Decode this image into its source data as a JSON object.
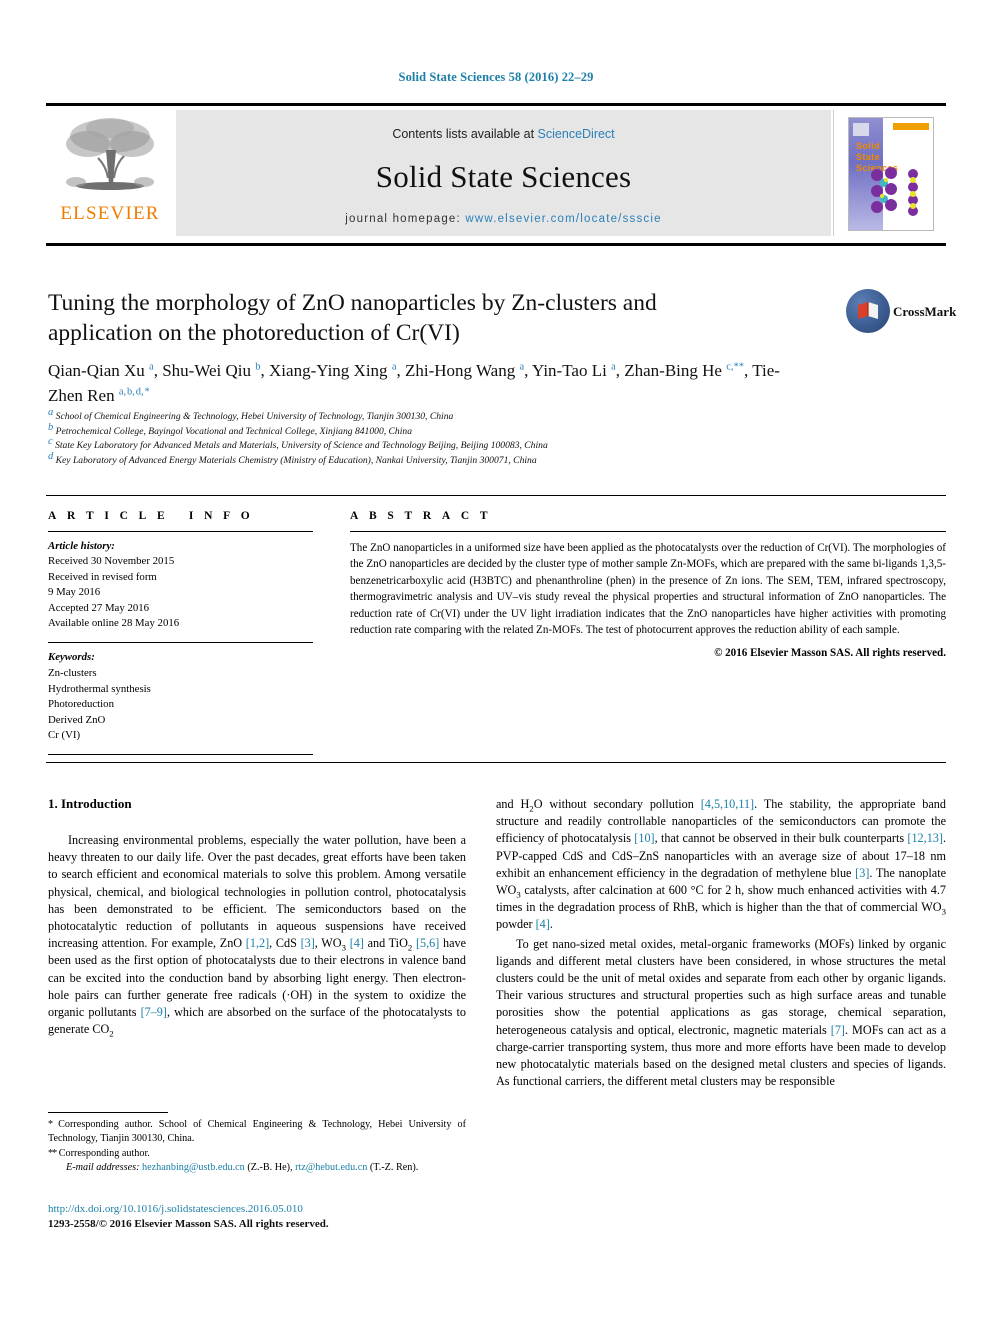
{
  "running_head": "Solid State Sciences 58 (2016) 22–29",
  "masthead": {
    "contents_prefix": "Contents lists available at ",
    "sciencedirect": "ScienceDirect",
    "journal_title": "Solid State Sciences",
    "homepage_prefix": "journal homepage: ",
    "homepage_url": "www.elsevier.com/locate/ssscie",
    "publisher_wordmark": "ELSEVIER",
    "publisher_color": "#f07d00",
    "link_color": "#2b7fb8",
    "cover": {
      "title_line1": "Solid",
      "title_line2": "State",
      "title_line3": "Sciences",
      "title_color": "#f08a00"
    }
  },
  "article": {
    "title": "Tuning the morphology of ZnO nanoparticles by Zn-clusters and application on the photoreduction of Cr(VI)",
    "crossmark_label": "CrossMark",
    "authors_html": "Qian-Qian Xu <sup>a</sup>, Shu-Wei Qiu <sup>b</sup>, Xiang-Ying Xing <sup>a</sup>, Zhi-Hong Wang <sup>a</sup>, Yin-Tao Li <sup>a</sup>, Zhan-Bing He <sup>c,&#42;&#42;</sup>, Tie-Zhen Ren <sup>a,&#8202;b,&#8202;d,&#8202;&#42;</sup>",
    "affiliations": [
      "School of Chemical Engineering & Technology, Hebei University of Technology, Tianjin 300130, China",
      "Petrochemical College, Bayingol Vocational and Technical College, Xinjiang 841000, China",
      "State Key Laboratory for Advanced Metals and Materials, University of Science and Technology Beijing, Beijing 100083, China",
      "Key Laboratory of Advanced Energy Materials Chemistry (Ministry of Education), Nankai University, Tianjin 300071, China"
    ],
    "affiliation_marks": [
      "a",
      "b",
      "c",
      "d"
    ]
  },
  "article_info": {
    "heading": "ARTICLE INFO",
    "history_label": "Article history:",
    "history": [
      "Received 30 November 2015",
      "Received in revised form",
      "9 May 2016",
      "Accepted 27 May 2016",
      "Available online 28 May 2016"
    ],
    "keywords_label": "Keywords:",
    "keywords": [
      "Zn-clusters",
      "Hydrothermal synthesis",
      "Photoreduction",
      "Derived ZnO",
      "Cr (VI)"
    ]
  },
  "abstract": {
    "heading": "ABSTRACT",
    "text": "The ZnO nanoparticles in a uniformed size have been applied as the photocatalysts over the reduction of Cr(VI). The morphologies of the ZnO nanoparticles are decided by the cluster type of mother sample Zn-MOFs, which are prepared with the same bi-ligands 1,3,5-benzenetricarboxylic acid (H3BTC) and phenanthroline (phen) in the presence of Zn ions. The SEM, TEM, infrared spectroscopy, thermogravimetric analysis and UV–vis study reveal the physical properties and structural information of ZnO nanoparticles. The reduction rate of Cr(VI) under the UV light irradiation indicates that the ZnO nanoparticles have higher activities with promoting reduction rate comparing with the related Zn-MOFs. The test of photocurrent approves the reduction ability of each sample.",
    "copyright": "© 2016 Elsevier Masson SAS. All rights reserved."
  },
  "body": {
    "section_heading": "1. Introduction",
    "left_paragraph_html": "Increasing environmental problems, especially the water pollution, have been a heavy threaten to our daily life. Over the past decades, great efforts have been taken to search efficient and economical materials to solve this problem. Among versatile physical, chemical, and biological technologies in pollution control, photocatalysis has been demonstrated to be efficient. The semiconductors based on the photocatalytic reduction of pollutants in aqueous suspensions have received increasing attention. For example, ZnO <span class=\"ref\">[1,2]</span>, CdS <span class=\"ref\">[3]</span>, WO<sub>3</sub> <span class=\"ref\">[4]</span> and TiO<sub>2</sub> <span class=\"ref\">[5,6]</span> have been used as the first option of photocatalysts due to their electrons in valence band can be excited into the conduction band by absorbing light energy. Then electron-hole pairs can further generate free radicals (&#183;OH) in the system to oxidize the organic pollutants <span class=\"ref\">[7–9]</span>, which are absorbed on the surface of the photocatalysts to generate CO<sub>2</sub>",
    "right_paragraph1_html": "and H<sub>2</sub>O without secondary pollution <span class=\"ref\">[4,5,10,11]</span>. The stability, the appropriate band structure and readily controllable nanoparticles of the semiconductors can promote the efficiency of photocatalysis <span class=\"ref\">[10]</span>, that cannot be observed in their bulk counterparts <span class=\"ref\">[12,13]</span>. PVP-capped CdS and CdS–ZnS nanoparticles with an average size of about 17–18 nm exhibit an enhancement efficiency in the degradation of methylene blue <span class=\"ref\">[3]</span>. The nanoplate WO<sub>3</sub> catalysts, after calcination at 600 °C for 2 h, show much enhanced activities with 4.7 times in the degradation process of RhB, which is higher than the that of commercial WO<sub>3</sub> powder <span class=\"ref\">[4]</span>.",
    "right_paragraph2_html": "To get nano-sized metal oxides, metal-organic frameworks (MOFs) linked by organic ligands and different metal clusters have been considered, in whose structures the metal clusters could be the unit of metal oxides and separate from each other by organic ligands. Their various structures and structural properties such as high surface areas and tunable porosities show the potential applications as gas storage, chemical separation, heterogeneous catalysis and optical, electronic, magnetic materials <span class=\"ref\">[7]</span>. MOFs can act as a charge-carrier transporting system, thus more and more efforts have been made to develop new photocatalytic materials based on the designed metal clusters and species of ligands. As functional carriers, the different metal clusters may be responsible"
  },
  "footnotes": {
    "line1_html": "<span class=\"star\">&#42;</span> Corresponding author. School of Chemical Engineering &amp; Technology, Hebei University of Technology, Tianjin 300130, China.",
    "line2_html": "<span class=\"star\">&#42;&#42;</span> Corresponding author.",
    "email_label": "E-mail addresses:",
    "email1": "hezhanbing@ustb.edu.cn",
    "email1_person": "(Z.-B. He)",
    "email2": "rtz@hebut.edu.cn",
    "email2_person": "(T.-Z. Ren).",
    "doi": "http://dx.doi.org/10.1016/j.solidstatesciences.2016.05.010",
    "issn_line": "1293-2558/© 2016 Elsevier Masson SAS. All rights reserved."
  }
}
